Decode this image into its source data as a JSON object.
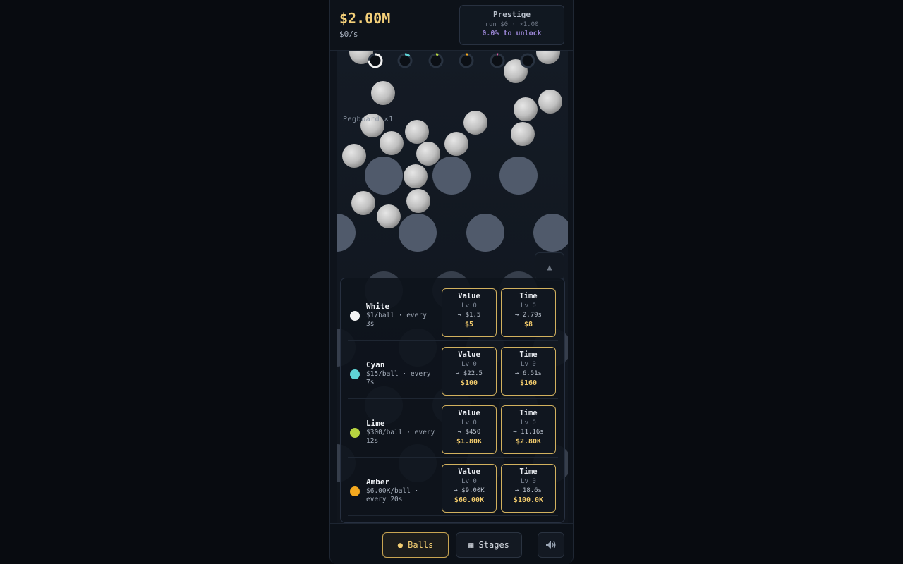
{
  "header": {
    "money": "$2.00M",
    "rate": "$0/s",
    "prestige": {
      "title": "Prestige",
      "subtitle": "run $0 · ×1.00",
      "unlock": "0.0% to unlock"
    }
  },
  "board": {
    "label": "Pegboard ×1",
    "collapse_icon": "▲"
  },
  "balls": [
    {
      "name": "White",
      "desc": "$1/ball · every 3s",
      "color": "#f2f2f2",
      "value": {
        "title": "Value",
        "level": "Lv 0",
        "next": "→ $1.5",
        "price": "$5"
      },
      "time": {
        "title": "Time",
        "level": "Lv 0",
        "next": "→ 2.79s",
        "price": "$8"
      }
    },
    {
      "name": "Cyan",
      "desc": "$15/ball · every 7s",
      "color": "#5fd3d6",
      "value": {
        "title": "Value",
        "level": "Lv 0",
        "next": "→ $22.5",
        "price": "$100"
      },
      "time": {
        "title": "Time",
        "level": "Lv 0",
        "next": "→ 6.51s",
        "price": "$160"
      }
    },
    {
      "name": "Lime",
      "desc": "$300/ball · every 12s",
      "color": "#b6d340",
      "value": {
        "title": "Value",
        "level": "Lv 0",
        "next": "→ $450",
        "price": "$1.80K"
      },
      "time": {
        "title": "Time",
        "level": "Lv 0",
        "next": "→ 11.16s",
        "price": "$2.80K"
      }
    },
    {
      "name": "Amber",
      "desc": "$6.00K/ball · every 20s",
      "color": "#f4a91f",
      "value": {
        "title": "Value",
        "level": "Lv 0",
        "next": "→ $9.00K",
        "price": "$60.00K"
      },
      "time": {
        "title": "Time",
        "level": "Lv 0",
        "next": "→ 18.6s",
        "price": "$100.0K"
      }
    }
  ],
  "timers": [
    {
      "color": "#f2f2f2",
      "progress": 0.75
    },
    {
      "color": "#5fd3d6",
      "progress": 0.12
    },
    {
      "color": "#b6d340",
      "progress": 0.06
    },
    {
      "color": "#f4a91f",
      "progress": 0.04
    },
    {
      "color": "#e05aa0",
      "progress": 0.02
    },
    {
      "color": "#ffffff",
      "progress": 0.01
    }
  ],
  "tabs": {
    "balls": "● Balls",
    "stages": "▦ Stages",
    "sound_icon": "speaker-icon"
  },
  "colors": {
    "accent": "#f2cb6c",
    "peg": "#5c6678",
    "prestige": "#9b86d6"
  }
}
